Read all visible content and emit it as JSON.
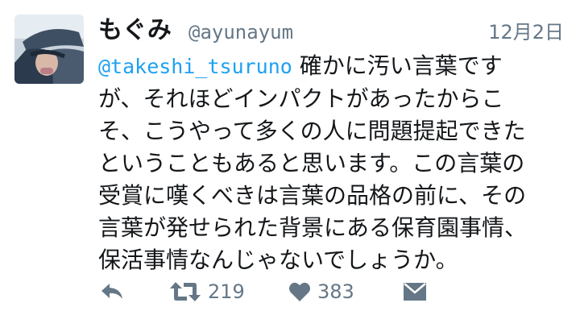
{
  "tweet": {
    "author": {
      "display_name": "もぐみ",
      "handle": "@ayunayum",
      "avatar": "user-avatar-photo"
    },
    "timestamp": "12月2日",
    "mention": "@takeshi_tsuruno",
    "text_lines": [
      " 確かに汚い言葉です",
      "が、それほどインパクトがあったからこ",
      "そ、こうやって多くの人に問題提起できた",
      "ということもあると思います。この言葉の",
      "受賞に嘆くべきは言葉の品格の前に、その",
      "言葉が発せられた背景にある保育園事情、",
      "保活事情なんじゃないでしょうか。"
    ],
    "actions": {
      "reply_icon": "reply-icon",
      "retweet_icon": "retweet-icon",
      "retweet_count": "219",
      "like_icon": "heart-icon",
      "like_count": "383",
      "dm_icon": "envelope-icon"
    },
    "colors": {
      "mention": "#1da1f2",
      "secondary_text": "#657786",
      "primary_text": "#14171a"
    }
  }
}
